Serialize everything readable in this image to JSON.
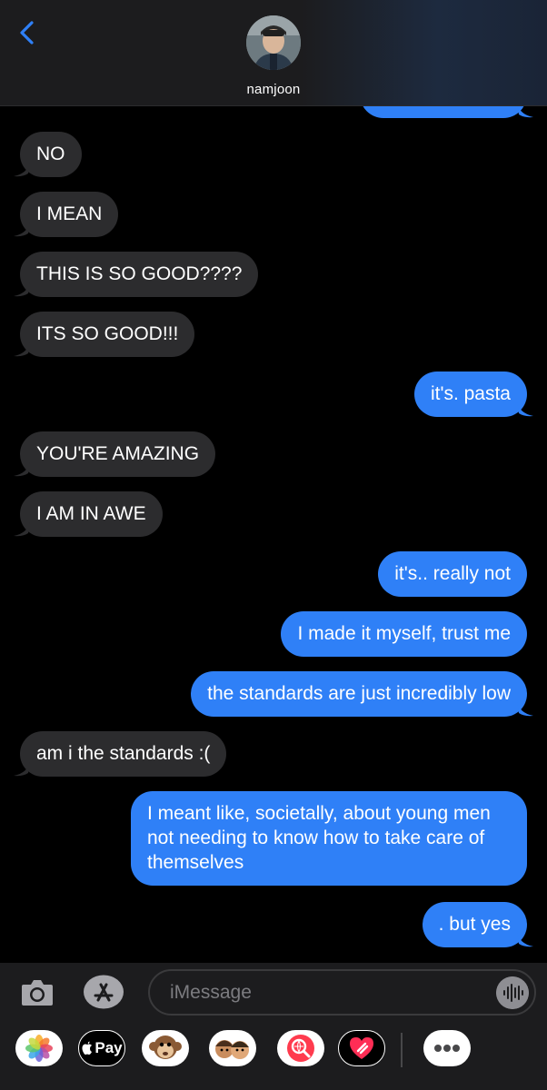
{
  "header": {
    "contact_name": "namjoon"
  },
  "messages": [
    {
      "dir": "in",
      "text": "NO"
    },
    {
      "dir": "in",
      "text": "I MEAN"
    },
    {
      "dir": "in",
      "text": "THIS IS SO GOOD????"
    },
    {
      "dir": "in",
      "text": "ITS SO GOOD!!!"
    },
    {
      "dir": "out",
      "text": "it's. pasta"
    },
    {
      "dir": "in",
      "text": "YOU'RE AMAZING"
    },
    {
      "dir": "in",
      "text": "I AM IN AWE"
    },
    {
      "dir": "out",
      "text": "it's.. really not"
    },
    {
      "dir": "out",
      "text": "I made it myself, trust me"
    },
    {
      "dir": "out",
      "text": "the standards are just incredibly low"
    },
    {
      "dir": "in",
      "text": "am i the standards :("
    },
    {
      "dir": "out",
      "text": "I meant like, societally, about young men not needing to know how to take care of themselves"
    },
    {
      "dir": "out",
      "text": ". but yes"
    }
  ],
  "composer": {
    "placeholder": "iMessage"
  },
  "app_drawer": {
    "apple_pay_label": "Pay",
    "items": [
      "photos-app",
      "apple-pay",
      "monkey-animoji",
      "memoji-stickers",
      "web-images-search",
      "digital-touch",
      "more-apps"
    ]
  },
  "colors": {
    "outgoing_bubble": "#2f80f7",
    "incoming_bubble": "#2c2c2e",
    "background": "#000000",
    "accent": "#2f80f7"
  }
}
